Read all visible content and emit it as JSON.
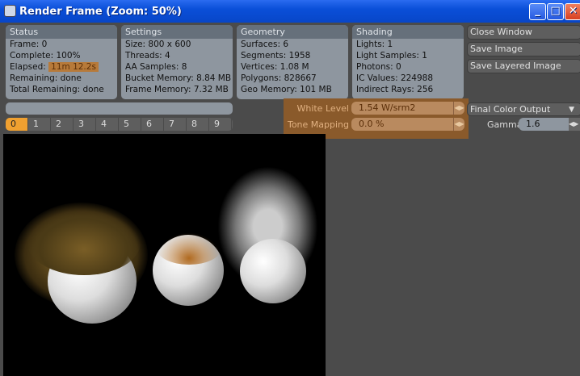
{
  "window": {
    "title": "Render Frame (Zoom: 50%)",
    "minimize": "_",
    "maximize": "□",
    "close": "✕"
  },
  "status": {
    "header": "Status",
    "frame": "Frame: 0",
    "complete": "Complete: 100%",
    "elapsed_label": "Elapsed:",
    "elapsed_value": "11m 12.2s",
    "remaining": "Remaining: done",
    "total_remaining": "Total Remaining: done"
  },
  "settings": {
    "header": "Settings",
    "size": "Size: 800 x 600",
    "threads": "Threads: 4",
    "aa": "AA Samples: 8",
    "bucket": "Bucket Memory: 8.84 MB",
    "frame_mem": "Frame Memory: 7.32 MB"
  },
  "geometry": {
    "header": "Geometry",
    "surfaces": "Surfaces: 6",
    "segments": "Segments: 1958",
    "vertices": "Vertices: 1.08 M",
    "polygons": "Polygons: 828667",
    "geo_mem": "Geo Memory: 101 MB"
  },
  "shading": {
    "header": "Shading",
    "lights": "Lights: 1",
    "light_samples": "Light Samples: 1",
    "photons": "Photons: 0",
    "ic": "IC Values: 224988",
    "indirect": "Indirect Rays: 256"
  },
  "buttons": {
    "close": "Close Window",
    "save": "Save Image",
    "save_layered": "Save Layered Image"
  },
  "progress": {
    "value_percent": 100
  },
  "frames": [
    "0",
    "1",
    "2",
    "3",
    "4",
    "5",
    "6",
    "7",
    "8",
    "9"
  ],
  "controls": {
    "white_level_label": "White Level",
    "white_level": "1.54 W/srm2",
    "tone_label": "Tone Mapping",
    "tone": "0.0 %",
    "output": "Final Color Output",
    "gamma_label": "Gamma",
    "gamma": "1.6"
  },
  "colors": {
    "accent": "#f0a030",
    "highlight": "#8a5a2b"
  }
}
